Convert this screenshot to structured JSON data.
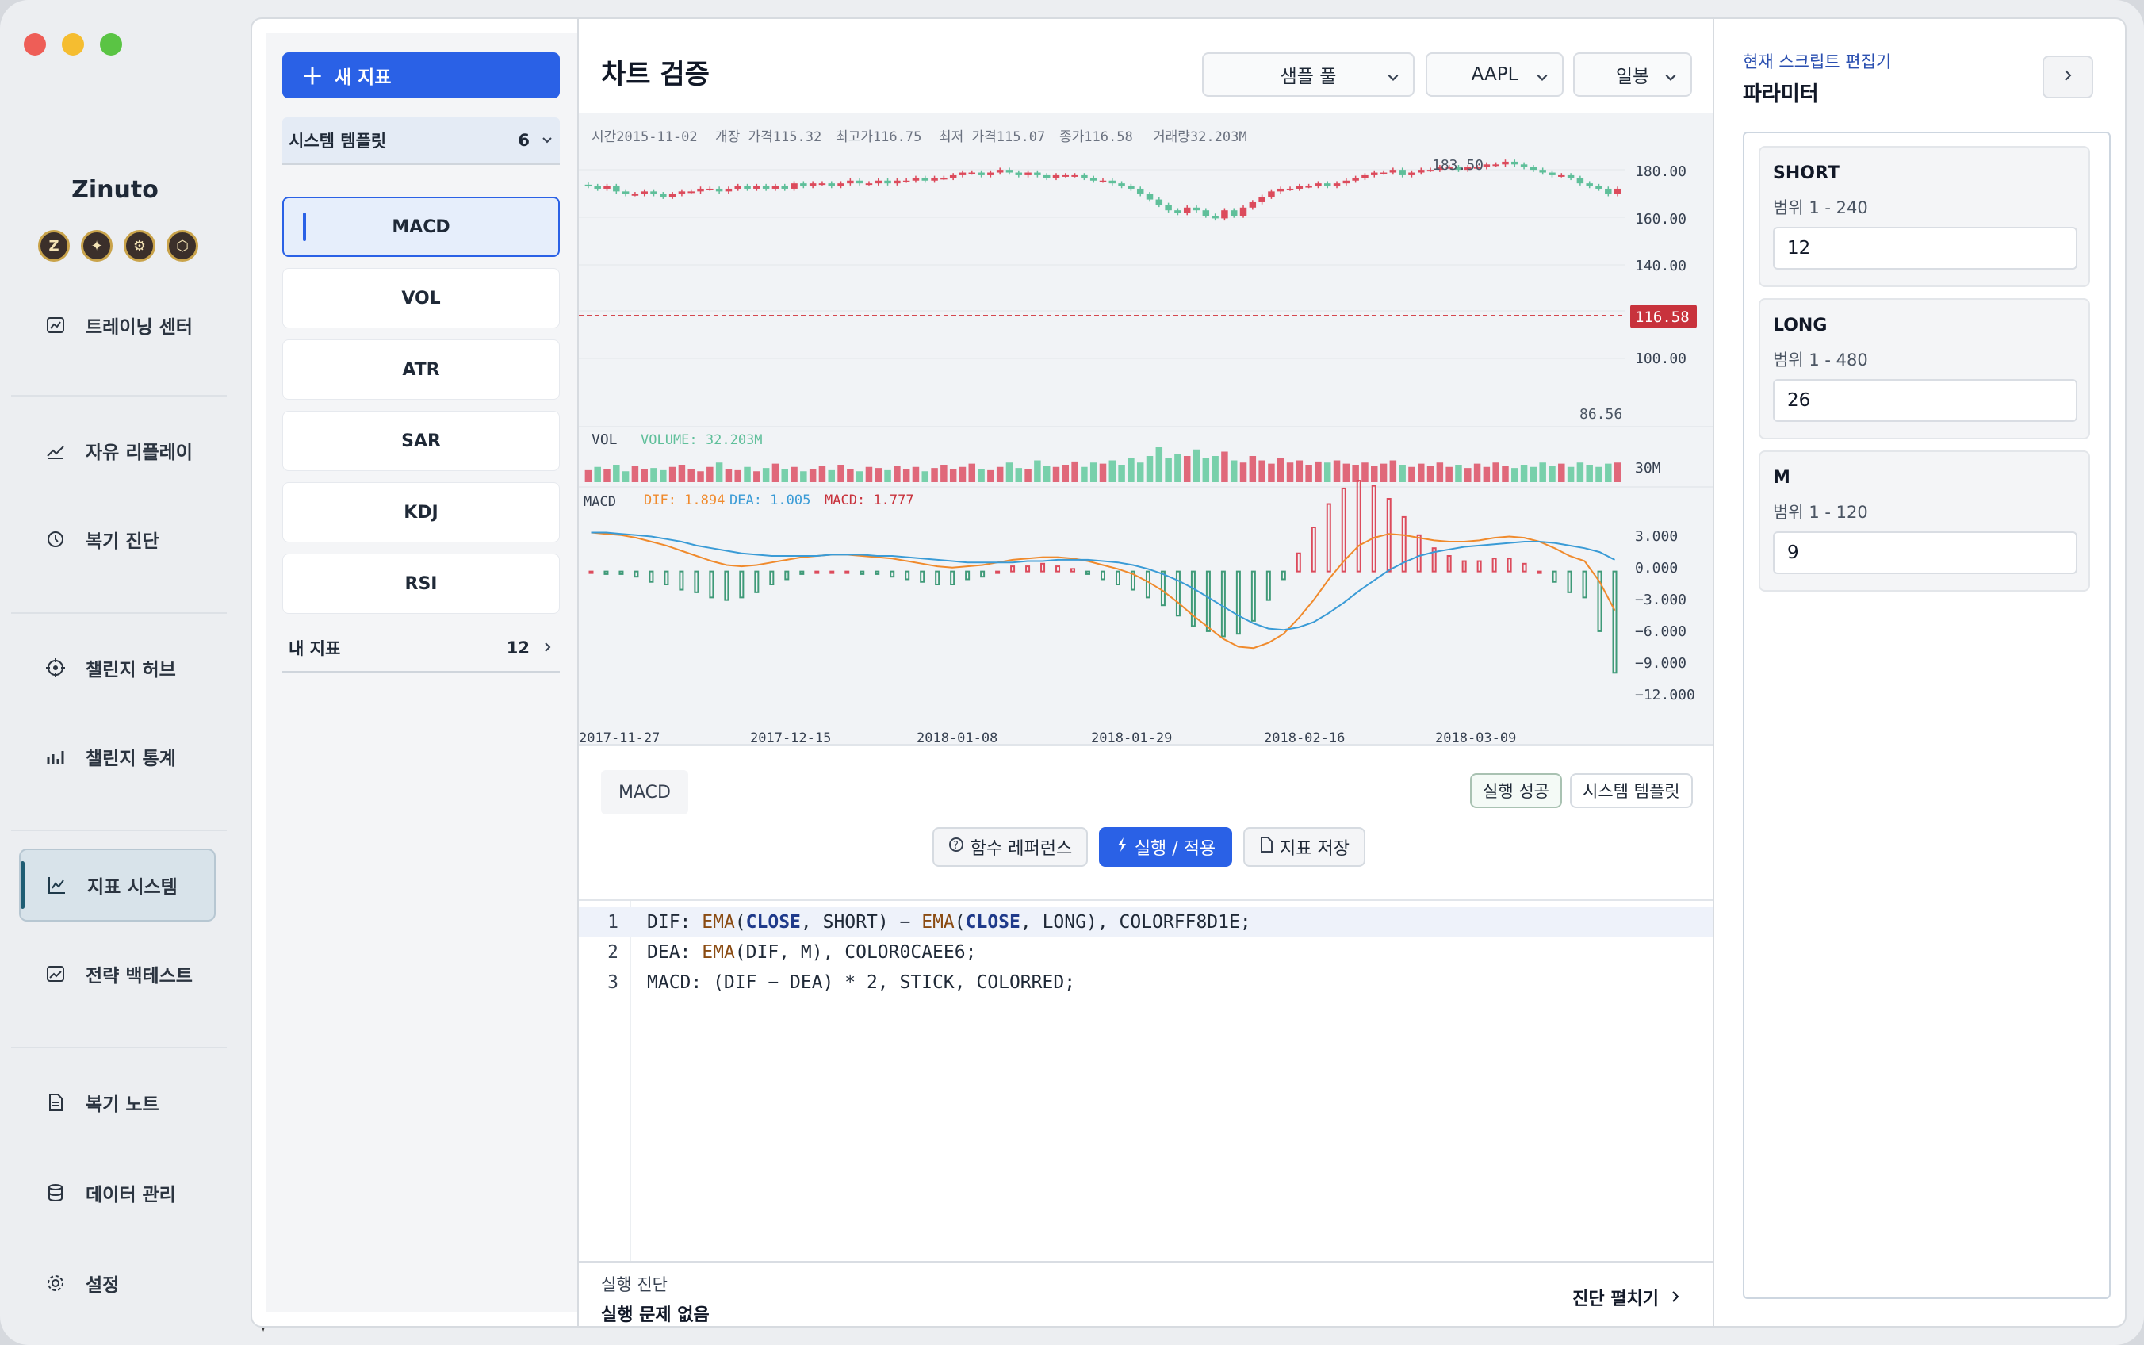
{
  "app": {
    "brand": "Zinuto",
    "brand_icons": [
      "Z",
      "✦",
      "⚙",
      "⬡"
    ]
  },
  "nav": [
    {
      "label": "트레이닝 센터",
      "icon": "chart-box-icon"
    },
    {
      "label": "자유 리플레이",
      "icon": "trend-icon"
    },
    {
      "label": "복기 진단",
      "icon": "history-icon"
    },
    {
      "label": "챌린지 허브",
      "icon": "target-icon"
    },
    {
      "label": "챌린지 통계",
      "icon": "stats-icon"
    },
    {
      "label": "지표 시스템",
      "icon": "line-chart-icon",
      "active": true
    },
    {
      "label": "전략 백테스트",
      "icon": "image-chart-icon"
    },
    {
      "label": "복기 노트",
      "icon": "note-icon"
    },
    {
      "label": "데이터 관리",
      "icon": "database-icon"
    },
    {
      "label": "설정",
      "icon": "gear-icon"
    }
  ],
  "left": {
    "new_button": "새 지표",
    "system_group": {
      "label": "시스템 템플릿",
      "count": "6"
    },
    "indicators": [
      "MACD",
      "VOL",
      "ATR",
      "SAR",
      "KDJ",
      "RSI"
    ],
    "my_group": {
      "label": "내 지표",
      "count": "12"
    }
  },
  "center": {
    "title": "차트 검증",
    "selects": [
      "샘플 풀",
      "AAPL",
      "일봉"
    ],
    "ohlc": [
      "시간2015-11-02",
      "개장 가격115.32",
      "최고가116.75",
      "최저 가격115.07",
      "종가116.58",
      "거래량32.203M"
    ],
    "price_axis": [
      "180.00",
      "160.00",
      "140.00",
      "100.00"
    ],
    "price_high_label": "183.50",
    "price_low_label": "86.56",
    "last_price": "116.58",
    "vol_label": "VOL",
    "vol_value": "VOLUME: 32.203M",
    "vol_axis": "30M",
    "macd_label": "MACD",
    "macd_dif": "DIF: 1.894",
    "macd_dea": "DEA: 1.005",
    "macd_val": "MACD: 1.777",
    "macd_axis": [
      "3.000",
      "0.000",
      "−3.000",
      "−6.000",
      "−9.000",
      "−12.000"
    ],
    "dates": [
      "2017-11-27",
      "2017-12-15",
      "2018-01-08",
      "2018-01-29",
      "2018-02-16",
      "2018-03-09"
    ],
    "editor": {
      "name": "MACD",
      "status": "실행 성공",
      "template": "시스템 템플릿",
      "btn_ref": "함수 레퍼런스",
      "btn_run": "실행 / 적용",
      "btn_save": "지표 저장"
    },
    "code": [
      {
        "n": "1",
        "parts": [
          [
            "DIF: ",
            ""
          ],
          [
            "EMA",
            "kw"
          ],
          [
            "(",
            ""
          ],
          [
            "CLOSE",
            "kb"
          ],
          [
            ", SHORT) − ",
            ""
          ],
          [
            "EMA",
            "kw"
          ],
          [
            "(",
            ""
          ],
          [
            "CLOSE",
            "kb"
          ],
          [
            ", LONG), COLORFF8D1E;",
            ""
          ]
        ]
      },
      {
        "n": "2",
        "parts": [
          [
            "DEA: ",
            ""
          ],
          [
            "EMA",
            "kw"
          ],
          [
            "(DIF, M), COLOR0CAEE6;",
            ""
          ]
        ]
      },
      {
        "n": "3",
        "parts": [
          [
            "MACD: (DIF − DEA) * 2, STICK, COLORRED;",
            ""
          ]
        ]
      }
    ],
    "diag": {
      "title": "실행 진단",
      "status": "실행 문제 없음",
      "expand": "진단 펼치기"
    }
  },
  "right": {
    "link": "현재 스크립트 편집기",
    "title": "파라미터",
    "params": [
      {
        "name": "SHORT",
        "range": "범위 1 - 240",
        "value": "12"
      },
      {
        "name": "LONG",
        "range": "범위 1 - 480",
        "value": "26"
      },
      {
        "name": "M",
        "range": "범위 1 - 120",
        "value": "9"
      }
    ]
  },
  "colors": {
    "accent": "#2a61e6",
    "up": "#dc4b5c",
    "down": "#5fbf9a",
    "dif": "#f08a2c",
    "dea": "#3a9bd6",
    "last": "#c8323c"
  },
  "chart_data": {
    "type": "candlestick",
    "title": "",
    "close": [
      171,
      170,
      171,
      169,
      168,
      168,
      169,
      168,
      167,
      168,
      169,
      169,
      170,
      170,
      169,
      170,
      171,
      170,
      171,
      170,
      171,
      170,
      172,
      171,
      172,
      172,
      171,
      172,
      173,
      172,
      172,
      173,
      172,
      173,
      173,
      174,
      173,
      174,
      174,
      175,
      176,
      176,
      175,
      176,
      177,
      176,
      175,
      176,
      175,
      174,
      175,
      175,
      175,
      174,
      173,
      173,
      172,
      171,
      170,
      168,
      166,
      164,
      162,
      161,
      163,
      162,
      160,
      159,
      162,
      160,
      163,
      165,
      167,
      169,
      170,
      170,
      171,
      171,
      172,
      171,
      172,
      173,
      174,
      175,
      176,
      176,
      177,
      175,
      176,
      177,
      177,
      178,
      178,
      177,
      178,
      178,
      179,
      179,
      180,
      179,
      178,
      177,
      176,
      175,
      175,
      174,
      172,
      171,
      170,
      168,
      170
    ],
    "volume": [
      0.55,
      0.7,
      0.6,
      0.8,
      0.5,
      0.75,
      0.6,
      0.65,
      0.55,
      0.7,
      0.8,
      0.6,
      0.5,
      0.7,
      0.9,
      0.6,
      0.55,
      0.7,
      0.5,
      0.65,
      0.85,
      0.6,
      0.7,
      0.5,
      0.6,
      0.75,
      0.55,
      0.8,
      0.6,
      0.5,
      0.7,
      0.65,
      0.55,
      0.75,
      0.6,
      0.7,
      0.5,
      0.65,
      0.8,
      0.6,
      0.7,
      0.85,
      0.6,
      0.55,
      0.7,
      0.9,
      0.65,
      0.6,
      1.0,
      0.75,
      0.7,
      0.8,
      0.95,
      0.7,
      0.9,
      0.85,
      1.0,
      0.8,
      1.1,
      0.9,
      1.2,
      1.6,
      1.1,
      1.3,
      1.2,
      1.5,
      1.1,
      1.2,
      1.4,
      1.0,
      0.9,
      1.2,
      1.0,
      0.85,
      1.1,
      0.9,
      1.0,
      0.8,
      0.95,
      0.9,
      1.0,
      0.85,
      0.8,
      0.9,
      0.75,
      0.85,
      1.0,
      0.8,
      0.7,
      0.85,
      0.75,
      0.9,
      0.7,
      0.8,
      0.65,
      0.85,
      0.7,
      0.9,
      0.75,
      0.65,
      0.8,
      0.7,
      0.9,
      0.75,
      0.85,
      0.7,
      0.9,
      0.8,
      0.7,
      0.85,
      0.9
    ],
    "dif": [
      3.0,
      2.9,
      2.8,
      2.6,
      2.3,
      2.0,
      1.6,
      1.2,
      0.8,
      0.5,
      0.4,
      0.5,
      0.7,
      0.9,
      1.1,
      1.2,
      1.3,
      1.3,
      1.2,
      1.1,
      1.0,
      0.8,
      0.6,
      0.4,
      0.3,
      0.4,
      0.5,
      0.7,
      0.9,
      1.0,
      1.1,
      1.1,
      1.0,
      0.8,
      0.5,
      0.2,
      -0.2,
      -0.8,
      -1.5,
      -2.4,
      -3.4,
      -4.3,
      -5.2,
      -5.8,
      -5.9,
      -5.5,
      -4.8,
      -3.6,
      -2.2,
      -0.6,
      0.8,
      2.0,
      2.6,
      2.9,
      2.8,
      2.6,
      2.4,
      2.3,
      2.3,
      2.4,
      2.6,
      2.7,
      2.6,
      2.3,
      1.8,
      1.2,
      0.8,
      -0.8,
      -3.0
    ],
    "dea": [
      3.0,
      3.0,
      2.9,
      2.8,
      2.7,
      2.5,
      2.3,
      2.0,
      1.8,
      1.6,
      1.4,
      1.3,
      1.2,
      1.2,
      1.2,
      1.2,
      1.3,
      1.3,
      1.3,
      1.2,
      1.2,
      1.1,
      1.0,
      0.9,
      0.8,
      0.7,
      0.7,
      0.7,
      0.7,
      0.8,
      0.8,
      0.9,
      0.9,
      0.9,
      0.8,
      0.7,
      0.5,
      0.2,
      -0.2,
      -0.7,
      -1.3,
      -2.0,
      -2.7,
      -3.4,
      -4.0,
      -4.4,
      -4.5,
      -4.3,
      -3.9,
      -3.2,
      -2.4,
      -1.5,
      -0.7,
      0.1,
      0.7,
      1.2,
      1.5,
      1.7,
      1.9,
      2.0,
      2.1,
      2.2,
      2.3,
      2.3,
      2.2,
      2.0,
      1.8,
      1.5,
      0.9
    ],
    "price_ylim": [
      86.56,
      183.5
    ],
    "macd_ylim": [
      -12,
      4.5
    ]
  }
}
